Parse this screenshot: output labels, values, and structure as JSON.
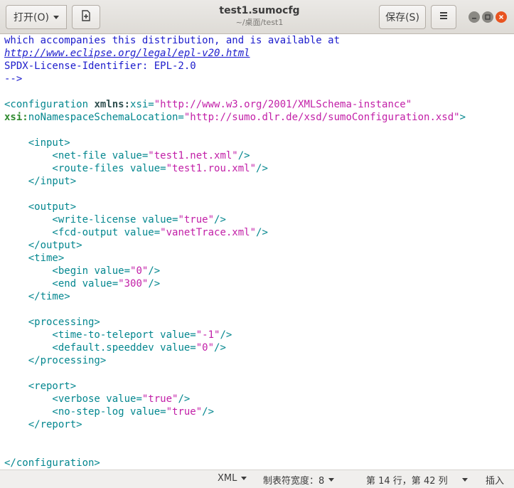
{
  "header": {
    "open_label": "打开(O)",
    "title": "test1.sumocfg",
    "subtitle": "~/桌面/test1",
    "save_label": "保存(S)",
    "new_icon": "new-document-icon",
    "menu_icon": "hamburger-menu-icon"
  },
  "editor": {
    "lines": [
      [
        {
          "t": "which accompanies this distribution, and is available at",
          "c": "comment"
        }
      ],
      [
        {
          "t": "http://www.eclipse.org/legal/epl-v20.html",
          "c": "link"
        }
      ],
      [
        {
          "t": "SPDX-License-Identifier: EPL-2.0",
          "c": "comment"
        }
      ],
      [
        {
          "t": "-->",
          "c": "comment"
        }
      ],
      [],
      [
        {
          "t": "<configuration ",
          "c": "tag"
        },
        {
          "t": "xmlns:",
          "c": "attrb"
        },
        {
          "t": "xsi=",
          "c": "attr"
        },
        {
          "t": "\"http://www.w3.org/2001/XMLSchema-instance\"",
          "c": "val"
        }
      ],
      [
        {
          "t": "xsi:",
          "c": "ns"
        },
        {
          "t": "noNamespaceSchemaLocation=",
          "c": "attr"
        },
        {
          "t": "\"http://sumo.dlr.de/xsd/sumoConfiguration.xsd\"",
          "c": "val"
        },
        {
          "t": ">",
          "c": "tag"
        }
      ],
      [],
      [
        {
          "t": "    <input>",
          "c": "tag"
        }
      ],
      [
        {
          "t": "        <net-file ",
          "c": "tag"
        },
        {
          "t": "value=",
          "c": "attr"
        },
        {
          "t": "\"test1.net.xml\"",
          "c": "val"
        },
        {
          "t": "/>",
          "c": "tag"
        }
      ],
      [
        {
          "t": "        <route-files ",
          "c": "tag"
        },
        {
          "t": "value=",
          "c": "attr"
        },
        {
          "t": "\"test1.rou.xml\"",
          "c": "val"
        },
        {
          "t": "/>",
          "c": "tag"
        }
      ],
      [
        {
          "t": "    </input>",
          "c": "tag"
        }
      ],
      [],
      [
        {
          "t": "    <output>",
          "c": "tag"
        }
      ],
      [
        {
          "t": "        <write-license ",
          "c": "tag"
        },
        {
          "t": "value=",
          "c": "attr"
        },
        {
          "t": "\"true\"",
          "c": "val"
        },
        {
          "t": "/>",
          "c": "tag"
        }
      ],
      [
        {
          "t": "        <fcd-output ",
          "c": "tag"
        },
        {
          "t": "value=",
          "c": "attr"
        },
        {
          "t": "\"vanetTrace.xml\"",
          "c": "val"
        },
        {
          "t": "/>",
          "c": "tag"
        }
      ],
      [
        {
          "t": "    </output>",
          "c": "tag"
        }
      ],
      [
        {
          "t": "    <time>",
          "c": "tag"
        }
      ],
      [
        {
          "t": "        <begin ",
          "c": "tag"
        },
        {
          "t": "value=",
          "c": "attr"
        },
        {
          "t": "\"0\"",
          "c": "val"
        },
        {
          "t": "/>",
          "c": "tag"
        }
      ],
      [
        {
          "t": "        <end ",
          "c": "tag"
        },
        {
          "t": "value=",
          "c": "attr"
        },
        {
          "t": "\"300\"",
          "c": "val"
        },
        {
          "t": "/>",
          "c": "tag"
        }
      ],
      [
        {
          "t": "    </time>",
          "c": "tag"
        }
      ],
      [],
      [
        {
          "t": "    <processing>",
          "c": "tag"
        }
      ],
      [
        {
          "t": "        <time-to-teleport ",
          "c": "tag"
        },
        {
          "t": "value=",
          "c": "attr"
        },
        {
          "t": "\"-1\"",
          "c": "val"
        },
        {
          "t": "/>",
          "c": "tag"
        }
      ],
      [
        {
          "t": "        <default.speeddev ",
          "c": "tag"
        },
        {
          "t": "value=",
          "c": "attr"
        },
        {
          "t": "\"0\"",
          "c": "val"
        },
        {
          "t": "/>",
          "c": "tag"
        }
      ],
      [
        {
          "t": "    </processing>",
          "c": "tag"
        }
      ],
      [],
      [
        {
          "t": "    <report>",
          "c": "tag"
        }
      ],
      [
        {
          "t": "        <verbose ",
          "c": "tag"
        },
        {
          "t": "value=",
          "c": "attr"
        },
        {
          "t": "\"true\"",
          "c": "val"
        },
        {
          "t": "/>",
          "c": "tag"
        }
      ],
      [
        {
          "t": "        <no-step-log ",
          "c": "tag"
        },
        {
          "t": "value=",
          "c": "attr"
        },
        {
          "t": "\"true\"",
          "c": "val"
        },
        {
          "t": "/>",
          "c": "tag"
        }
      ],
      [
        {
          "t": "    </report>",
          "c": "tag"
        }
      ],
      [],
      [],
      [
        {
          "t": "</configuration>",
          "c": "tag"
        }
      ]
    ]
  },
  "statusbar": {
    "language": "XML",
    "tab_width": "制表符宽度：8",
    "position": "第 14 行，第 42 列",
    "mode": "插入"
  }
}
